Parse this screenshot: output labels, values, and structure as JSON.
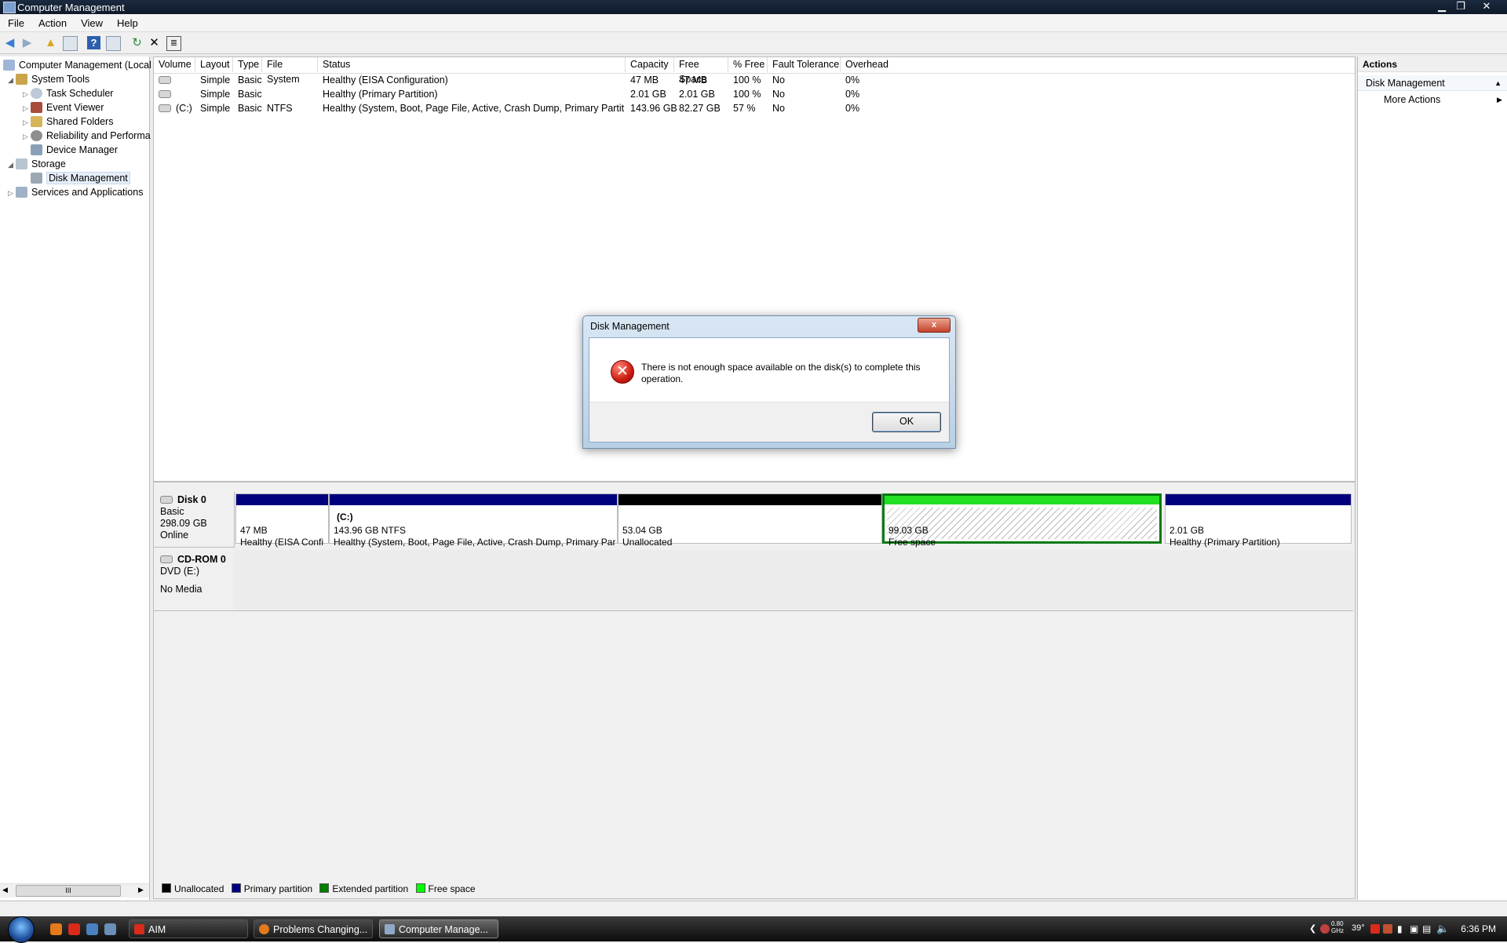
{
  "window": {
    "title": "Computer Management",
    "minimize": "▁",
    "maximize": "❐",
    "close": "✕"
  },
  "menu": [
    "File",
    "Action",
    "View",
    "Help"
  ],
  "toolbar": {
    "icons": [
      "back-icon",
      "forward-icon",
      "up-folder-icon",
      "show-hide-tree-icon",
      "help-icon",
      "show-hide-action-pane-icon",
      "refresh-icon",
      "delete-icon",
      "properties-icon"
    ]
  },
  "tree": {
    "root": "Computer Management (Local",
    "system_tools": "System Tools",
    "task_scheduler": "Task Scheduler",
    "event_viewer": "Event Viewer",
    "shared_folders": "Shared Folders",
    "reliability": "Reliability and Performa",
    "device_manager": "Device Manager",
    "storage": "Storage",
    "disk_management": "Disk Management",
    "services": "Services and Applications",
    "scroll_thumb": "III"
  },
  "volumes": {
    "columns": [
      "Volume",
      "Layout",
      "Type",
      "File System",
      "Status",
      "Capacity",
      "Free Space",
      "% Free",
      "Fault Tolerance",
      "Overhead"
    ],
    "rows": [
      {
        "volume": "",
        "layout": "Simple",
        "type": "Basic",
        "fs": "",
        "status": "Healthy (EISA Configuration)",
        "capacity": "47 MB",
        "free": "47 MB",
        "pct": "100 %",
        "fault": "No",
        "overhead": "0%"
      },
      {
        "volume": "",
        "layout": "Simple",
        "type": "Basic",
        "fs": "",
        "status": "Healthy (Primary Partition)",
        "capacity": "2.01 GB",
        "free": "2.01 GB",
        "pct": "100 %",
        "fault": "No",
        "overhead": "0%"
      },
      {
        "volume": "(C:)",
        "layout": "Simple",
        "type": "Basic",
        "fs": "NTFS",
        "status": "Healthy (System, Boot, Page File, Active, Crash Dump, Primary Partition)",
        "capacity": "143.96 GB",
        "free": "82.27 GB",
        "pct": "57 %",
        "fault": "No",
        "overhead": "0%"
      }
    ]
  },
  "disks": {
    "disk0": {
      "name": "Disk 0",
      "type": "Basic",
      "size": "298.09 GB",
      "state": "Online",
      "partitions": [
        {
          "label": "",
          "size": "47 MB",
          "status": "Healthy (EISA Confi",
          "kind": "primary"
        },
        {
          "label": "(C:)",
          "size": "143.96 GB NTFS",
          "status": "Healthy (System, Boot, Page File, Active, Crash Dump, Primary Part",
          "kind": "primary"
        },
        {
          "label": "",
          "size": "53.04 GB",
          "status": "Unallocated",
          "kind": "unallocated"
        },
        {
          "label": "",
          "size": "99.03 GB",
          "status": "Free space",
          "kind": "free"
        },
        {
          "label": "",
          "size": "2.01 GB",
          "status": "Healthy (Primary Partition)",
          "kind": "primary"
        }
      ]
    },
    "cdrom0": {
      "name": "CD-ROM 0",
      "drive": "DVD (E:)",
      "media": "No Media"
    }
  },
  "legend": [
    {
      "label": "Unallocated",
      "color": "#000000"
    },
    {
      "label": "Primary partition",
      "color": "#00007f"
    },
    {
      "label": "Extended partition",
      "color": "#007f00"
    },
    {
      "label": "Free space",
      "color": "#00ff00"
    }
  ],
  "actions": {
    "header": "Actions",
    "section": "Disk Management",
    "more": "More Actions"
  },
  "dialog": {
    "title": "Disk Management",
    "message": "There is not enough space available on the disk(s) to complete this operation.",
    "ok": "OK",
    "close": "x"
  },
  "taskbar": {
    "tasks": [
      {
        "label": "AIM",
        "active": false
      },
      {
        "label": "Problems Changing...",
        "active": false
      },
      {
        "label": "Computer Manage...",
        "active": true
      }
    ],
    "tray_cpu": "0.80 GHz",
    "tray_temp": "39°",
    "clock": "6:36 PM"
  },
  "colors": {
    "primary": "#00007f",
    "unallocated": "#000000",
    "extended": "#007f00",
    "free": "#00ff00",
    "title_bar": "#14233a"
  }
}
